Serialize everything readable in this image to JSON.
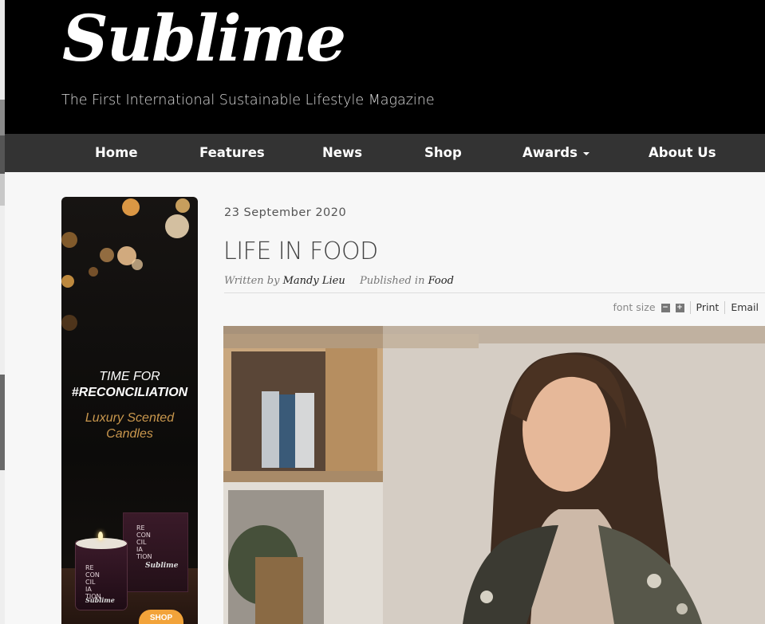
{
  "site": {
    "logo_text": "Sublime",
    "tagline": "The First International Sustainable Lifestyle Magazine"
  },
  "nav": {
    "items": [
      {
        "label": "Home"
      },
      {
        "label": "Features"
      },
      {
        "label": "News"
      },
      {
        "label": "Shop"
      },
      {
        "label": "Awards",
        "has_dropdown": true,
        "icon": "caret-down-icon"
      },
      {
        "label": "About Us"
      }
    ]
  },
  "ad": {
    "title_line1": "TIME FOR",
    "title_line2": "#RECONCILIATION",
    "subtitle_line1": "Luxury Scented",
    "subtitle_line2": "Candles",
    "box_text": [
      "RE",
      "CON",
      "CIL",
      "IA",
      "TION"
    ],
    "box_brand": "Sublime",
    "candle_text": [
      "RE",
      "CON",
      "CIL",
      "IA",
      "TION"
    ],
    "candle_brand": "Sublime",
    "shop_label": "SHOP",
    "accent_color": "#f2a33a"
  },
  "article": {
    "date": "23 September 2020",
    "title": "LIFE IN FOOD",
    "written_by_label": "Written by",
    "author": "Mandy Lieu",
    "published_in_label": "Published in",
    "category": "Food",
    "image_subject": "Portrait of a woman with long wavy hair in a floral kimono"
  },
  "tools": {
    "font_size_label": "font size",
    "decrease_icon": "minus-icon",
    "increase_icon": "plus-icon",
    "print_label": "Print",
    "email_label": "Email"
  }
}
